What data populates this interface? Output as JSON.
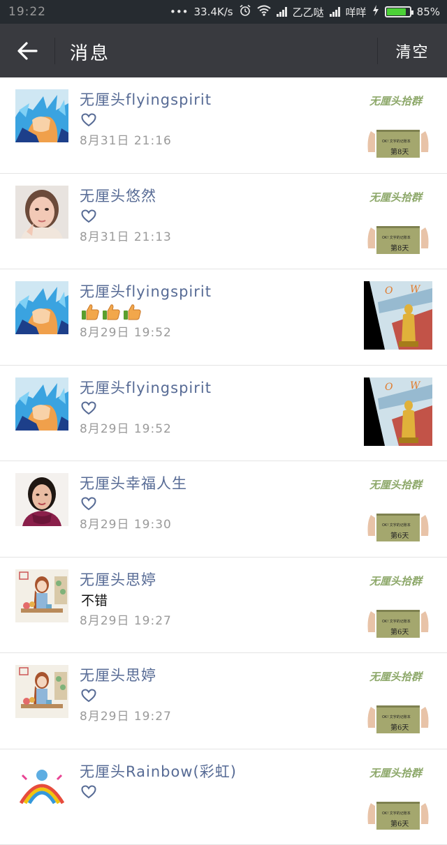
{
  "status_bar": {
    "time": "19:22",
    "dots": "•••",
    "network_speed": "33.4K/s",
    "carrier1": "乙乙哒",
    "carrier2": "咩咩",
    "battery": "85%",
    "battery_level": 0.85
  },
  "header": {
    "title": "消息",
    "clear_label": "清空"
  },
  "thumb_overlay": {
    "group_name": "无厘头拾群",
    "day_label_8": "第8天",
    "day_label_6": "第6天",
    "book_sub": "OK! 文字的记账本"
  },
  "messages": [
    {
      "name": "无厘头flyingspirit",
      "content_type": "heart",
      "time": "8月31日  21:16",
      "avatar": "blue-hair-avatar",
      "thumb": "green-book-day8"
    },
    {
      "name": "无厘头悠然",
      "content_type": "heart",
      "time": "8月31日  21:13",
      "avatar": "woman-portrait-avatar",
      "thumb": "green-book-day8"
    },
    {
      "name": "无厘头flyingspirit",
      "content_type": "thumbs",
      "time": "8月29日  19:52",
      "avatar": "blue-hair-avatar",
      "thumb": "oscar-poster"
    },
    {
      "name": "无厘头flyingspirit",
      "content_type": "heart",
      "time": "8月29日  19:52",
      "avatar": "blue-hair-avatar",
      "thumb": "oscar-poster"
    },
    {
      "name": "无厘头幸福人生",
      "content_type": "heart",
      "time": "8月29日  19:30",
      "avatar": "woman-scarf-avatar",
      "thumb": "green-book-day6"
    },
    {
      "name": "无厘头思婷",
      "content_type": "text",
      "content": "不错",
      "time": "8月29日  19:27",
      "avatar": "illustration-girl-avatar",
      "thumb": "green-book-day6"
    },
    {
      "name": "无厘头思婷",
      "content_type": "heart",
      "time": "8月29日  19:27",
      "avatar": "illustration-girl-avatar",
      "thumb": "green-book-day6"
    },
    {
      "name": "无厘头Rainbow(彩虹)",
      "content_type": "heart",
      "time": "",
      "avatar": "rainbow-avatar",
      "thumb": "green-book-day6"
    }
  ],
  "colors": {
    "name_blue": "#576b95",
    "header_bg": "#393a3f",
    "statusbar_bg": "#262b30",
    "battery_green": "#4cd137"
  }
}
